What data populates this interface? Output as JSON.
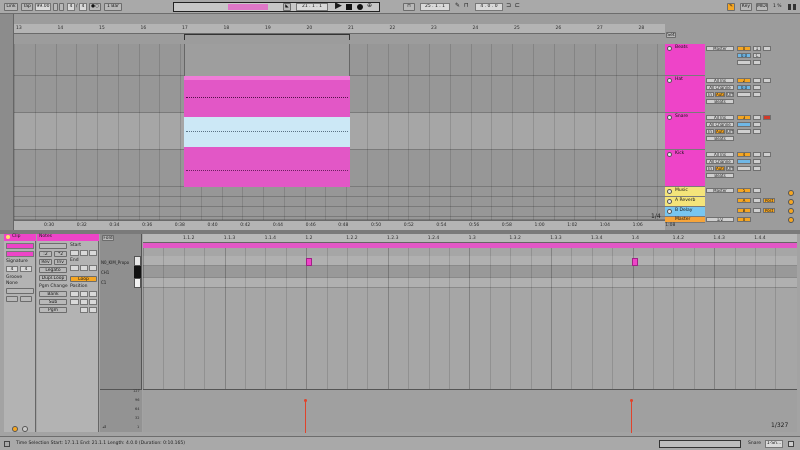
{
  "transport": {
    "link_label": "Link",
    "tap_label": "Tap",
    "tempo": "99.00",
    "sig_num": "4",
    "sig_den": "4",
    "metro": "●○",
    "quant": "1 Bar",
    "position": "21 .  1 .  1",
    "loop_start": "25 .  1 .  1",
    "loop_len": "4 .  0 .  0",
    "key_label": "Key",
    "midi_label": "MIDI",
    "cpu": "1 %"
  },
  "arrangement": {
    "bar_ticks": [
      "13",
      "14",
      "15",
      "16",
      "17",
      "18",
      "19",
      "20",
      "21",
      "22",
      "23",
      "24",
      "25",
      "26",
      "27",
      "28"
    ],
    "time_ticks": [
      "0:30",
      "0:32",
      "0:34",
      "0:36",
      "0:38",
      "0:40",
      "0:42",
      "0:44",
      "0:46",
      "0:48",
      "0:50",
      "0:52",
      "0:54",
      "0:56",
      "0:58",
      "1:00",
      "1:02",
      "1:04",
      "1:06",
      "1:08"
    ],
    "page": "1/4",
    "set_label": "Set"
  },
  "tracks": [
    {
      "name": "Beats",
      "color": "#ee44c8",
      "routing": "Master",
      "vol": "1",
      "pan": "C",
      "s": "S",
      "m": "Mute",
      "num": "0",
      "extra": "0.0"
    },
    {
      "name": "Hat",
      "color": "#ee44c8",
      "in": "All Ins",
      "ch": "All Channe",
      "mon_in": "In",
      "mon_auto": "Auto",
      "mon_off": "Off",
      "out": "Beats",
      "num": "2",
      "vol": "0",
      "pan": "C",
      "s": "S",
      "m": "Mute",
      "extra": "0.0"
    },
    {
      "name": "Snare",
      "color": "#ee44c8",
      "in": "All Ins",
      "ch": "All Channe",
      "mon_in": "In",
      "mon_auto": "Auto",
      "mon_off": "Off",
      "out": "Beats",
      "num": "3",
      "vol": "0",
      "pan": "C",
      "s": "S",
      "m": "Mute"
    },
    {
      "name": "Kick",
      "color": "#ee44c8",
      "in": "All Ins",
      "ch": "All Channe",
      "mon_in": "In",
      "mon_auto": "Auto",
      "mon_off": "Off",
      "out": "Beats",
      "num": "4",
      "vol": "0",
      "pan": "C",
      "s": "S",
      "m": "Mute"
    },
    {
      "name": "Music",
      "color": "#f4e47a",
      "routing": "Master",
      "num": "5"
    },
    {
      "name": "A Reverb",
      "color": "#f4e47a",
      "num": "A",
      "post": "Post"
    },
    {
      "name": "B Delay",
      "color": "#78c6f0",
      "num": "B",
      "post": "Post"
    },
    {
      "name": "Master",
      "color": "#f6a43a",
      "routing": "1/2",
      "num": "0"
    }
  ],
  "clip_panel": {
    "clip_title": "Clip",
    "notes_title": "Notes",
    "start_label": "Start",
    "end_label": "End",
    "signature_label": "Signature",
    "sig_num": "4",
    "sig_den": "4",
    "groove_label": "Groove",
    "groove_value": "None",
    "rev_label": "Rev",
    "inv_label": "Inv",
    "legato_label": "Legato",
    "dupl_label": "Dupl.Loop",
    "loop_label": "Loop",
    "pgm_label": "Pgm Change",
    "position_label": "Position",
    "bank_label": "Bank",
    "sub_label": "Sub",
    "pgm_sel": "Pgm",
    "fold_label": "Fold"
  },
  "piano_roll": {
    "beat_ticks": [
      "1.1.2",
      "1.1.3",
      "1.1.4",
      "1.2",
      "1.2.2",
      "1.2.3",
      "1.2.4",
      "1.3",
      "1.3.2",
      "1.3.3",
      "1.3.4",
      "1.4",
      "1.4.2",
      "1.4.3",
      "1.4.4"
    ],
    "key_labels": [
      "N0_KIM_Propo",
      "CH1",
      "C1"
    ],
    "velocity_labels": [
      "127",
      "96",
      "64",
      "32",
      "1"
    ],
    "page": "1/327"
  },
  "status": {
    "selection": "Time Selection   Start: 17.1.1   End: 21.1.1   Length: 4.0.0   (Duration: 0:10.165)",
    "right_label": "Snare",
    "right_value": "1-Sn..."
  }
}
